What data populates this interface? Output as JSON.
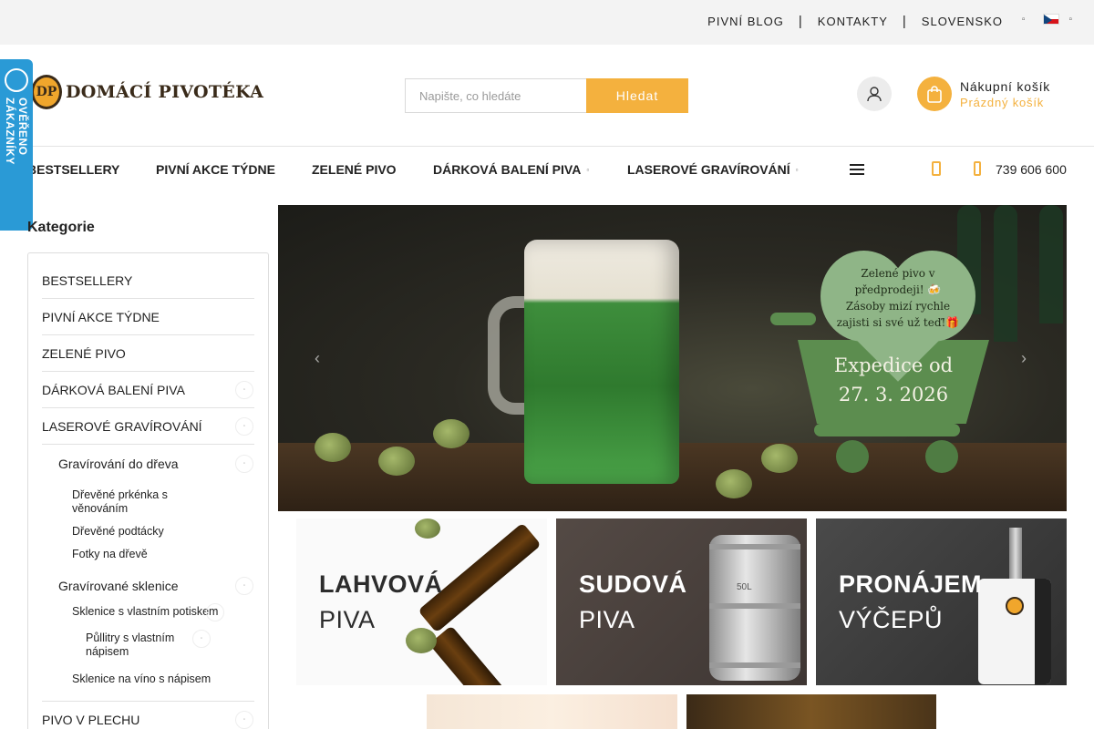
{
  "topbar": {
    "links": [
      "PIVNÍ BLOG",
      "KONTAKTY",
      "SLOVENSKO"
    ],
    "separator": "|",
    "language_flag": "czech-flag-icon"
  },
  "header": {
    "logo_mark": "DP",
    "logo_text": "DOMÁCÍ PIVOTÉKA",
    "search_placeholder": "Napište, co hledáte",
    "search_button": "Hledat",
    "cart_title": "Nákupní košík",
    "cart_status": "Prázdný košík",
    "accent_color": "#f4b13e"
  },
  "nav": {
    "items": [
      "BESTSELLERY",
      "PIVNÍ AKCE TÝDNE",
      "ZELENÉ PIVO",
      "DÁRKOVÁ BALENÍ PIVA",
      "LASEROVÉ GRAVÍROVÁNÍ"
    ],
    "phone": "739 606 600"
  },
  "badge": {
    "text": "OVĚŘENO ZÁKAZNÍKY",
    "color": "#2a9ad6"
  },
  "sidebar": {
    "title": "Kategorie",
    "items": [
      "BESTSELLERY",
      "PIVNÍ AKCE TÝDNE",
      "ZELENÉ PIVO",
      "DÁRKOVÁ BALENÍ PIVA",
      "LASEROVÉ GRAVÍROVÁNÍ",
      "Gravírování do dřeva",
      "Dřevěné prkénka s věnováním",
      "Dřevěné podtácky",
      "Fotky na dřevě",
      "Gravírované sklenice",
      "Sklenice s vlastním potiskem",
      "Půllitry s vlastním nápisem",
      "Sklenice na víno s nápisem",
      "PIVO V PLECHU"
    ]
  },
  "banner": {
    "heart_text": [
      "Zelené pivo v",
      "předprodeji! 🍻",
      "Zásoby mizí rychle",
      "zajisti si své už teď!🎁"
    ],
    "expedition_text": [
      "Expedice od",
      "27. 3. 2026"
    ],
    "prev_arrow": "‹",
    "next_arrow": "›"
  },
  "tiles": [
    {
      "line1": "LAHVOVÁ",
      "line2": "PIVA"
    },
    {
      "line1": "SUDOVÁ",
      "line2": "PIVA",
      "keg_label": "50L"
    },
    {
      "line1": "PRONÁJEM",
      "line2": "VÝČEPŮ"
    }
  ]
}
